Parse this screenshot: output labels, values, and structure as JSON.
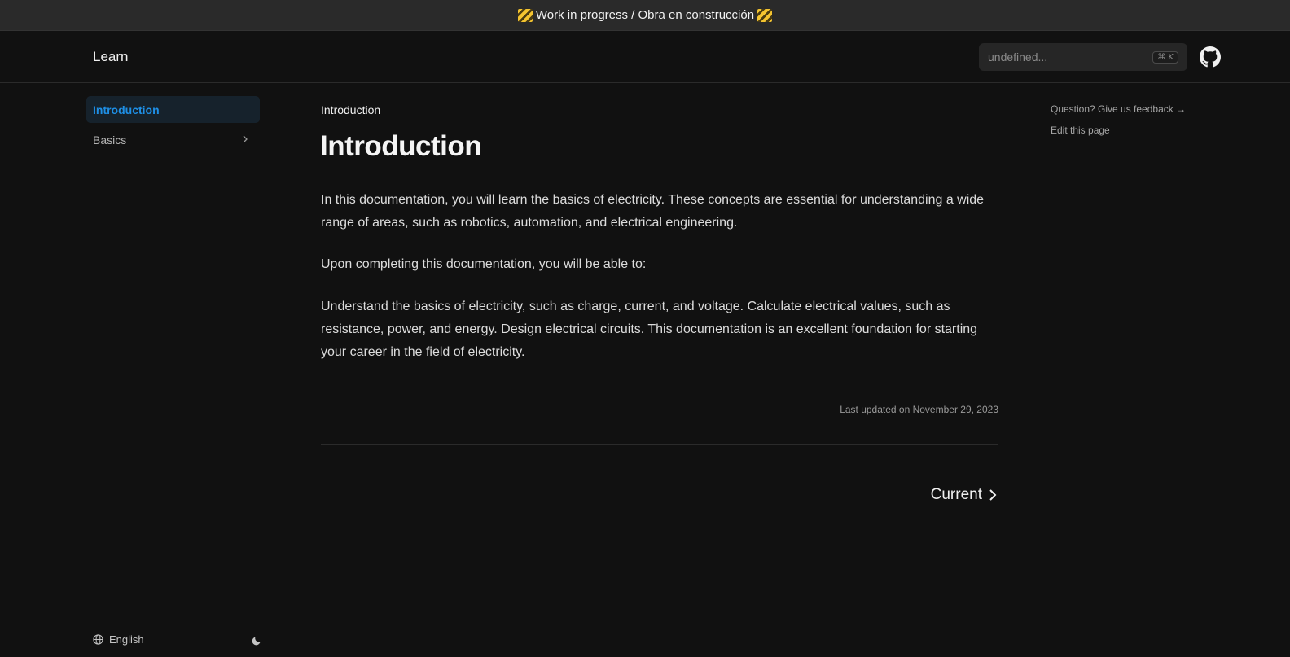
{
  "banner": {
    "text": "Work in progress / Obra en construcción"
  },
  "navbar": {
    "logo": "Learn",
    "search_placeholder": "undefined...",
    "search_shortcut": "⌘ K"
  },
  "sidebar": {
    "items": [
      {
        "label": "Introduction",
        "active": true
      },
      {
        "label": "Basics",
        "active": false
      }
    ],
    "language": "English"
  },
  "main": {
    "breadcrumb": "Introduction",
    "title": "Introduction",
    "paragraphs": [
      "In this documentation, you will learn the basics of electricity. These concepts are essential for understanding a wide range of areas, such as robotics, automation, and electrical engineering.",
      "Upon completing this documentation, you will be able to:",
      "Understand the basics of electricity, such as charge, current, and voltage. Calculate electrical values, such as resistance, power, and energy. Design electrical circuits. This documentation is an excellent foundation for starting your career in the field of electricity."
    ],
    "last_updated": "Last updated on November 29, 2023",
    "next_label": "Current"
  },
  "toc": {
    "feedback": "Question? Give us feedback →",
    "edit": "Edit this page"
  },
  "colors": {
    "accent": "#1e8fe6",
    "background": "#111111"
  }
}
